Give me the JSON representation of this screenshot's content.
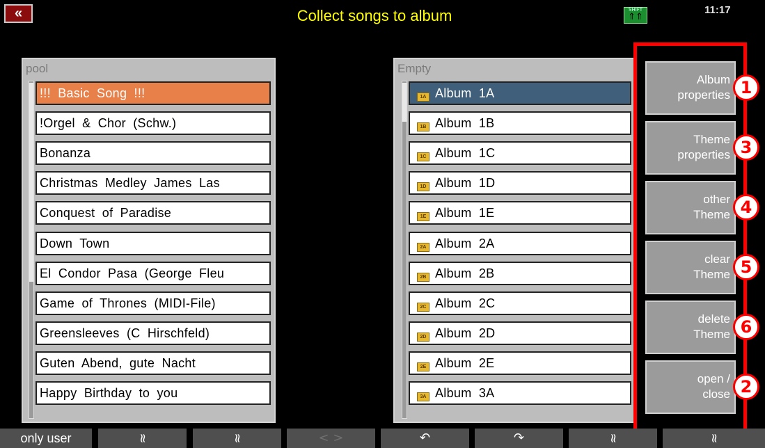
{
  "header": {
    "back_icon": "«",
    "title": "Collect songs to album",
    "shift_label": "SHIFT",
    "shift_arrows": "⇑⇑",
    "time": "11:17"
  },
  "pool": {
    "title": "pool",
    "items": [
      "!!! Basic Song !!!",
      "!Orgel & Chor (Schw.)",
      "Bonanza",
      "Christmas Medley James Las",
      "Conquest of Paradise",
      "Down Town",
      "El Condor Pasa (George Fleu",
      "Game of Thrones (MIDI-File)",
      "Greensleeves (C Hirschfeld)",
      "Guten Abend, gute Nacht",
      "Happy Birthday to you"
    ]
  },
  "albums": {
    "title": "Empty",
    "items": [
      {
        "icon": "1A",
        "label": "Album 1A"
      },
      {
        "icon": "1B",
        "label": "Album 1B"
      },
      {
        "icon": "1C",
        "label": "Album 1C"
      },
      {
        "icon": "1D",
        "label": "Album 1D"
      },
      {
        "icon": "1E",
        "label": "Album 1E"
      },
      {
        "icon": "2A",
        "label": "Album 2A"
      },
      {
        "icon": "2B",
        "label": "Album 2B"
      },
      {
        "icon": "2C",
        "label": "Album 2C"
      },
      {
        "icon": "2D",
        "label": "Album 2D"
      },
      {
        "icon": "2E",
        "label": "Album 2E"
      },
      {
        "icon": "3A",
        "label": "Album 3A"
      }
    ]
  },
  "side_buttons": [
    {
      "line1": "Album",
      "line2": "properties",
      "badge": "1"
    },
    {
      "line1": "Theme",
      "line2": "properties",
      "badge": "3"
    },
    {
      "line1": "other",
      "line2": "Theme",
      "badge": "4"
    },
    {
      "line1": "clear",
      "line2": "Theme",
      "badge": "5"
    },
    {
      "line1": "delete",
      "line2": "Theme",
      "badge": "6"
    },
    {
      "line1": "open /",
      "line2": "close",
      "badge": "2"
    }
  ],
  "bottom_bar": {
    "only_user": "only user",
    "page_up": "≈",
    "page_down": "≈",
    "left_right": "< >",
    "undo_icon": "↶",
    "redo_icon": "↷",
    "up2": "≈",
    "down2": "≈"
  },
  "colors": {
    "selected_song": "#e8804a",
    "selected_album": "#3f5f7a",
    "title": "#ffff00",
    "annotation": "#ff0000"
  }
}
